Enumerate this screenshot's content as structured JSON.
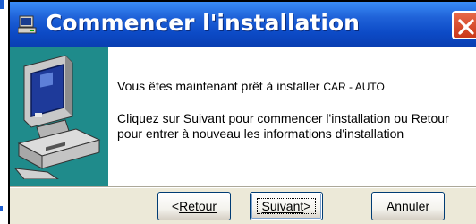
{
  "window": {
    "title": "Commencer l'installation",
    "title_color": "#ffffff",
    "titlebar_color": "#0c4ac6",
    "close_icon": "close-icon"
  },
  "content": {
    "line1_prefix": "Vous êtes maintenant prêt à installer ",
    "product": "CAR - AUTO",
    "line2": "Cliquez sur Suivant pour commencer l'installation ou Retour",
    "line3": "pour entrer à nouveau les informations d'installation",
    "side_panel_color": "#1f8b8b",
    "illustration_icon": "computer-icon"
  },
  "buttons": {
    "back": {
      "label": "Retour",
      "prefix": "<",
      "accesskey": "R"
    },
    "next": {
      "label": "Suivant",
      "suffix": ">",
      "accesskey": "S"
    },
    "cancel": {
      "label": "Annuler"
    }
  }
}
